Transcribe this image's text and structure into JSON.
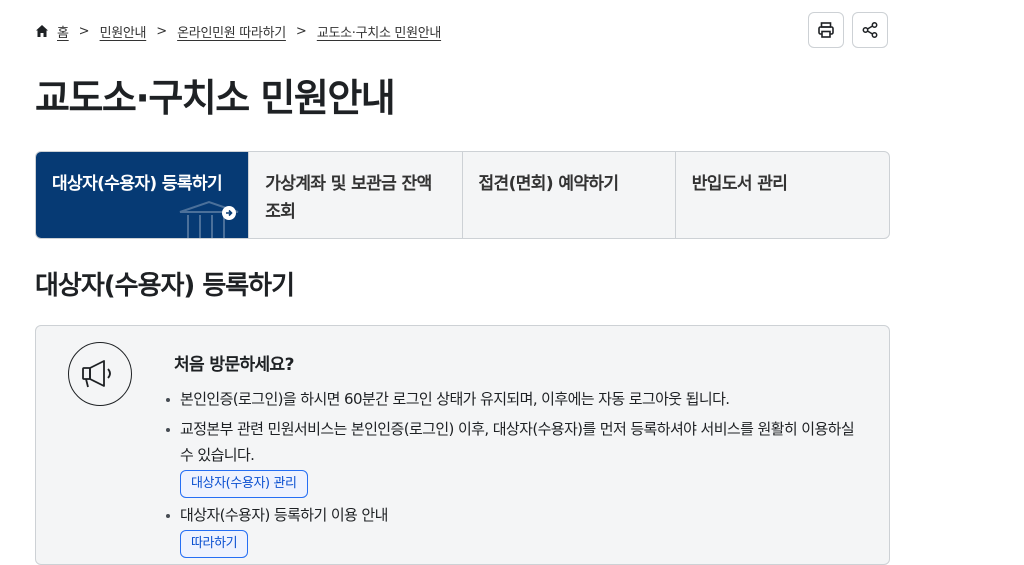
{
  "breadcrumb": {
    "home": "홈",
    "items": [
      "민원안내",
      "온라인민원 따라하기",
      "교도소·구치소 민원안내"
    ]
  },
  "page_title": "교도소·구치소 민원안내",
  "tabs": [
    {
      "label": "대상자(수용자) 등록하기",
      "active": true
    },
    {
      "label": "가상계좌 및 보관금 잔액 조회",
      "active": false
    },
    {
      "label": "접견(면회) 예약하기",
      "active": false
    },
    {
      "label": "반입도서 관리",
      "active": false
    }
  ],
  "section_title": "대상자(수용자) 등록하기",
  "notice": {
    "heading": "처음 방문하세요?",
    "items": [
      "본인인증(로그인)을 하시면 60분간 로그인 상태가 유지되며, 이후에는 자동 로그아웃 됩니다.",
      "교정본부 관련 민원서비스는 본인인증(로그인) 이후, 대상자(수용자)를 먼저 등록하셔야 서비스를 원활히 이용하실 수 있습니다.",
      "대상자(수용자) 등록하기 이용 안내"
    ],
    "manage_button": "대상자(수용자) 관리",
    "guide_button": "따라하기"
  },
  "colors": {
    "accent": "#063a74",
    "link": "#256ef4",
    "panel": "#f4f5f6",
    "border": "#cdd1d5"
  }
}
